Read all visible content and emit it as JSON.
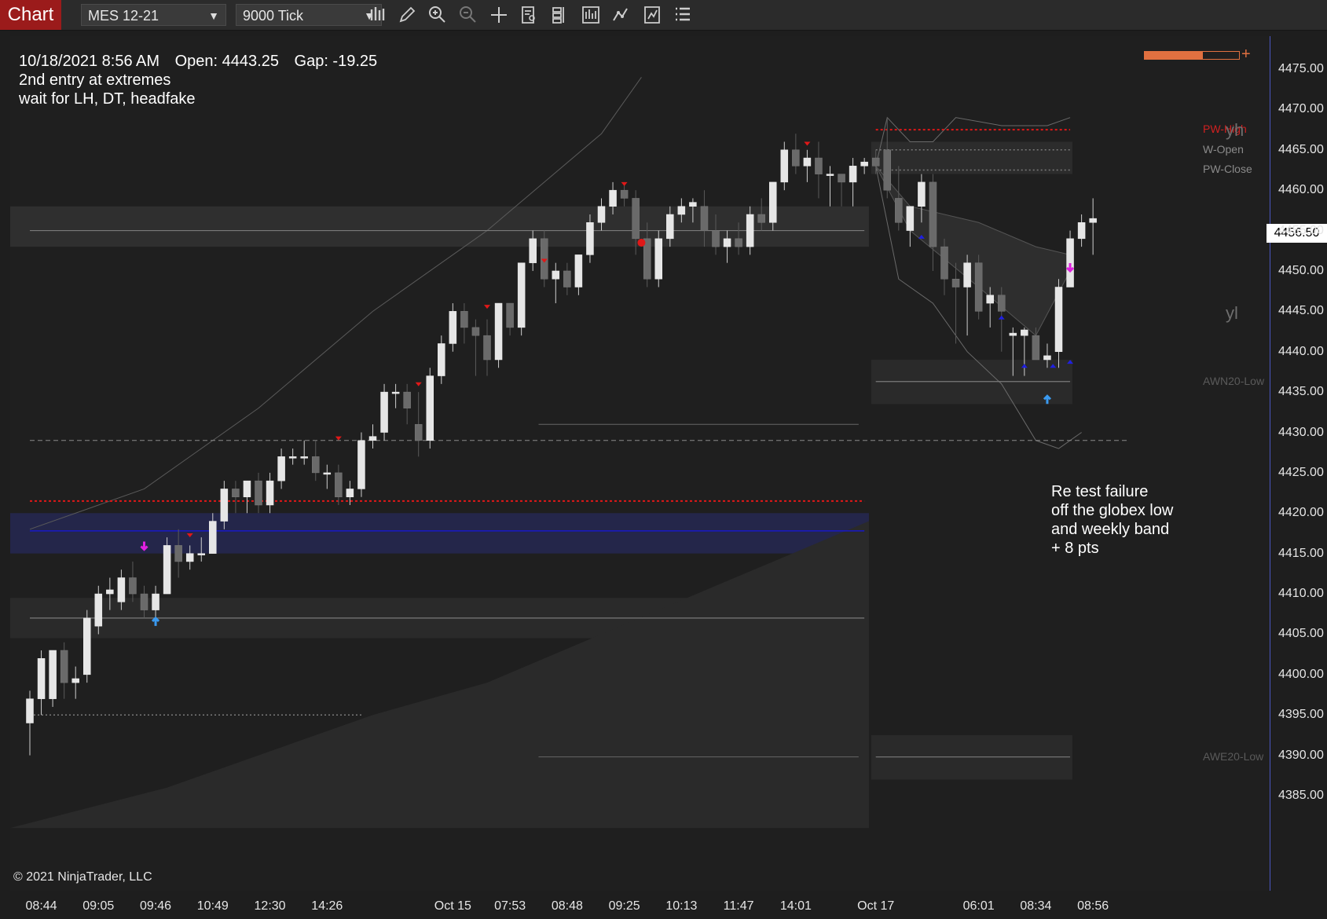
{
  "toolbar": {
    "app_tab": "Chart",
    "instrument": "MES 12-21",
    "period": "9000 Tick",
    "tools": [
      {
        "icon": "bar-type-icon"
      },
      {
        "icon": "draw-pencil-icon"
      },
      {
        "icon": "zoom-in-icon"
      },
      {
        "icon": "zoom-out-icon"
      },
      {
        "icon": "crosshair-icon"
      },
      {
        "icon": "data-box-icon"
      },
      {
        "icon": "templates-icon"
      },
      {
        "icon": "indicators-icon"
      },
      {
        "icon": "strategies-icon"
      },
      {
        "icon": "chart-properties-icon"
      },
      {
        "icon": "menu-list-icon"
      }
    ]
  },
  "info": {
    "datetime": "10/18/2021 8:56 AM",
    "open": "Open: 4443.25",
    "gap": "Gap: -19.25",
    "line2": "2nd entry at extremes",
    "line3": "wait for LH, DT, headfake"
  },
  "annotation": [
    "Re test failure",
    "off the globex low",
    "and weekly band",
    "+ 8 pts"
  ],
  "copyright": "© 2021 NinjaTrader, LLC",
  "level_labels": [
    {
      "text": "PW-High",
      "price": 4467.5,
      "color": "#d02020"
    },
    {
      "text": "W-Open",
      "price": 4465.0,
      "color": "#8a8a8a"
    },
    {
      "text": "PW-Close",
      "price": 4462.5,
      "color": "#8a8a8a"
    },
    {
      "text": "AWN20-Low",
      "price": 4436.3,
      "color": "#5a5a5a"
    },
    {
      "text": "AWE20-Low",
      "price": 4389.8,
      "color": "#5a5a5a"
    }
  ],
  "tags": [
    {
      "text": "yh",
      "price": 4467.5
    },
    {
      "text": "yl",
      "price": 4444.8
    }
  ],
  "last_price": "4456.50",
  "zoom_fraction": 0.62,
  "colors": {
    "up_candle": "#e6e6e6",
    "down_candle": "#6a6a6a",
    "red_level": "#e01818",
    "blue_level": "#1818c8",
    "axis_border": "#4a56c0"
  },
  "chart_data": {
    "type": "candlestick",
    "instrument": "MES 12-21",
    "ylim": [
      4381,
      4479
    ],
    "y_ticks": [
      4385,
      4390,
      4395,
      4400,
      4405,
      4410,
      4415,
      4420,
      4425,
      4430,
      4435,
      4440,
      4445,
      4450,
      4455,
      4460,
      4465,
      4470,
      4475
    ],
    "x_ticks": [
      {
        "label": "08:44",
        "index": 1
      },
      {
        "label": "09:05",
        "index": 6
      },
      {
        "label": "09:46",
        "index": 11
      },
      {
        "label": "10:49",
        "index": 16
      },
      {
        "label": "12:30",
        "index": 21
      },
      {
        "label": "14:26",
        "index": 26
      },
      {
        "label": "Oct 15",
        "index": 37
      },
      {
        "label": "07:53",
        "index": 42
      },
      {
        "label": "08:48",
        "index": 47
      },
      {
        "label": "09:25",
        "index": 52
      },
      {
        "label": "10:13",
        "index": 57
      },
      {
        "label": "11:47",
        "index": 62
      },
      {
        "label": "14:01",
        "index": 67
      },
      {
        "label": "Oct 17",
        "index": 74
      },
      {
        "label": "06:01",
        "index": 83
      },
      {
        "label": "08:34",
        "index": 88
      },
      {
        "label": "08:56",
        "index": 93
      }
    ],
    "candles": [
      {
        "o": 4394,
        "h": 4398,
        "l": 4390,
        "c": 4397
      },
      {
        "o": 4397,
        "h": 4403,
        "l": 4395,
        "c": 4402
      },
      {
        "o": 4397,
        "h": 4403,
        "l": 4396,
        "c": 4403
      },
      {
        "o": 4403,
        "h": 4404,
        "l": 4397,
        "c": 4399
      },
      {
        "o": 4399,
        "h": 4401,
        "l": 4397,
        "c": 4399.5
      },
      {
        "o": 4400,
        "h": 4408,
        "l": 4399,
        "c": 4407
      },
      {
        "o": 4406,
        "h": 4411,
        "l": 4405,
        "c": 4410
      },
      {
        "o": 4410,
        "h": 4412,
        "l": 4408,
        "c": 4410.5
      },
      {
        "o": 4409,
        "h": 4413,
        "l": 4408,
        "c": 4412
      },
      {
        "o": 4412,
        "h": 4414,
        "l": 4409,
        "c": 4410
      },
      {
        "o": 4410,
        "h": 4411,
        "l": 4407,
        "c": 4408
      },
      {
        "o": 4408,
        "h": 4411,
        "l": 4407,
        "c": 4410
      },
      {
        "o": 4410,
        "h": 4417,
        "l": 4410,
        "c": 4416
      },
      {
        "o": 4416,
        "h": 4418,
        "l": 4412,
        "c": 4414
      },
      {
        "o": 4414,
        "h": 4416,
        "l": 4413,
        "c": 4415
      },
      {
        "o": 4415,
        "h": 4417,
        "l": 4414,
        "c": 4415
      },
      {
        "o": 4415,
        "h": 4420,
        "l": 4415,
        "c": 4419
      },
      {
        "o": 4419,
        "h": 4424,
        "l": 4418,
        "c": 4423
      },
      {
        "o": 4423,
        "h": 4424,
        "l": 4420,
        "c": 4422
      },
      {
        "o": 4422,
        "h": 4424,
        "l": 4420,
        "c": 4424
      },
      {
        "o": 4424,
        "h": 4425,
        "l": 4420,
        "c": 4421
      },
      {
        "o": 4421,
        "h": 4425,
        "l": 4420,
        "c": 4424
      },
      {
        "o": 4424,
        "h": 4428,
        "l": 4423,
        "c": 4427
      },
      {
        "o": 4427,
        "h": 4428,
        "l": 4426,
        "c": 4427
      },
      {
        "o": 4427,
        "h": 4429,
        "l": 4426,
        "c": 4427
      },
      {
        "o": 4427,
        "h": 4429,
        "l": 4424,
        "c": 4425
      },
      {
        "o": 4425,
        "h": 4426,
        "l": 4423,
        "c": 4425
      },
      {
        "o": 4425,
        "h": 4426,
        "l": 4421,
        "c": 4422
      },
      {
        "o": 4422,
        "h": 4424,
        "l": 4421,
        "c": 4423
      },
      {
        "o": 4423,
        "h": 4430,
        "l": 4422,
        "c": 4429
      },
      {
        "o": 4429,
        "h": 4431,
        "l": 4428,
        "c": 4429.5
      },
      {
        "o": 4430,
        "h": 4436,
        "l": 4429,
        "c": 4435
      },
      {
        "o": 4435,
        "h": 4436,
        "l": 4433,
        "c": 4435
      },
      {
        "o": 4435,
        "h": 4436,
        "l": 4431,
        "c": 4433
      },
      {
        "o": 4431,
        "h": 4435,
        "l": 4427,
        "c": 4429
      },
      {
        "o": 4429,
        "h": 4438,
        "l": 4428,
        "c": 4437
      },
      {
        "o": 4437,
        "h": 4442,
        "l": 4436,
        "c": 4441
      },
      {
        "o": 4441,
        "h": 4446,
        "l": 4440,
        "c": 4445
      },
      {
        "o": 4445,
        "h": 4446,
        "l": 4441,
        "c": 4443
      },
      {
        "o": 4443,
        "h": 4444,
        "l": 4437,
        "c": 4442
      },
      {
        "o": 4442,
        "h": 4444,
        "l": 4437,
        "c": 4439
      },
      {
        "o": 4439,
        "h": 4446,
        "l": 4438,
        "c": 4446
      },
      {
        "o": 4446,
        "h": 4446,
        "l": 4442,
        "c": 4443
      },
      {
        "o": 4443,
        "h": 4451,
        "l": 4442,
        "c": 4451
      },
      {
        "o": 4451,
        "h": 4455,
        "l": 4450,
        "c": 4454
      },
      {
        "o": 4454,
        "h": 4455,
        "l": 4448,
        "c": 4449
      },
      {
        "o": 4449,
        "h": 4451,
        "l": 4446,
        "c": 4450
      },
      {
        "o": 4450,
        "h": 4451,
        "l": 4447,
        "c": 4448
      },
      {
        "o": 4448,
        "h": 4452,
        "l": 4447,
        "c": 4452
      },
      {
        "o": 4452,
        "h": 4457,
        "l": 4451,
        "c": 4456
      },
      {
        "o": 4456,
        "h": 4459,
        "l": 4455,
        "c": 4458
      },
      {
        "o": 4458,
        "h": 4461,
        "l": 4457,
        "c": 4460
      },
      {
        "o": 4460,
        "h": 4461,
        "l": 4458,
        "c": 4459
      },
      {
        "o": 4459,
        "h": 4460,
        "l": 4452,
        "c": 4454
      },
      {
        "o": 4454,
        "h": 4456,
        "l": 4448,
        "c": 4449
      },
      {
        "o": 4449,
        "h": 4455,
        "l": 4448,
        "c": 4454
      },
      {
        "o": 4454,
        "h": 4458,
        "l": 4453,
        "c": 4457
      },
      {
        "o": 4457,
        "h": 4459,
        "l": 4456,
        "c": 4458
      },
      {
        "o": 4458,
        "h": 4459,
        "l": 4456,
        "c": 4458.5
      },
      {
        "o": 4458,
        "h": 4460,
        "l": 4453,
        "c": 4455
      },
      {
        "o": 4455,
        "h": 4457,
        "l": 4452,
        "c": 4453
      },
      {
        "o": 4453,
        "h": 4455,
        "l": 4451,
        "c": 4454
      },
      {
        "o": 4454,
        "h": 4456,
        "l": 4452,
        "c": 4453
      },
      {
        "o": 4453,
        "h": 4458,
        "l": 4452,
        "c": 4457
      },
      {
        "o": 4457,
        "h": 4459,
        "l": 4455,
        "c": 4456
      },
      {
        "o": 4456,
        "h": 4461,
        "l": 4455,
        "c": 4461
      },
      {
        "o": 4461,
        "h": 4466,
        "l": 4460,
        "c": 4465
      },
      {
        "o": 4465,
        "h": 4467,
        "l": 4462,
        "c": 4463
      },
      {
        "o": 4463,
        "h": 4465,
        "l": 4461,
        "c": 4464
      },
      {
        "o": 4464,
        "h": 4466,
        "l": 4459,
        "c": 4462
      },
      {
        "o": 4462,
        "h": 4463,
        "l": 4458,
        "c": 4462
      },
      {
        "o": 4462,
        "h": 4462,
        "l": 4458,
        "c": 4461
      },
      {
        "o": 4461,
        "h": 4464,
        "l": 4458,
        "c": 4463
      },
      {
        "o": 4463,
        "h": 4464,
        "l": 4462,
        "c": 4463.5
      },
      {
        "o": 4464,
        "h": 4465,
        "l": 4462,
        "c": 4463
      },
      {
        "o": 4465,
        "h": 4469,
        "l": 4459,
        "c": 4460
      },
      {
        "o": 4459,
        "h": 4463,
        "l": 4455,
        "c": 4456
      },
      {
        "o": 4455,
        "h": 4457,
        "l": 4453,
        "c": 4458
      },
      {
        "o": 4458,
        "h": 4462,
        "l": 4456,
        "c": 4461
      },
      {
        "o": 4461,
        "h": 4462,
        "l": 4450,
        "c": 4453
      },
      {
        "o": 4453,
        "h": 4454,
        "l": 4447,
        "c": 4449
      },
      {
        "o": 4449,
        "h": 4451,
        "l": 4441,
        "c": 4448
      },
      {
        "o": 4448,
        "h": 4452,
        "l": 4442,
        "c": 4451
      },
      {
        "o": 4451,
        "h": 4452,
        "l": 4444,
        "c": 4445
      },
      {
        "o": 4446,
        "h": 4448,
        "l": 4443,
        "c": 4447
      },
      {
        "o": 4447,
        "h": 4448,
        "l": 4440,
        "c": 4445
      },
      {
        "o": 4442,
        "h": 4443,
        "l": 4437,
        "c": 4442.3
      },
      {
        "o": 4442,
        "h": 4443,
        "l": 4437,
        "c": 4442.7
      },
      {
        "o": 4442,
        "h": 4443,
        "l": 4439,
        "c": 4439
      },
      {
        "o": 4439,
        "h": 4441,
        "l": 4438,
        "c": 4439.5
      },
      {
        "o": 4440,
        "h": 4449,
        "l": 4438,
        "c": 4448
      },
      {
        "o": 4448,
        "h": 4455,
        "l": 4448,
        "c": 4454
      },
      {
        "o": 4454,
        "h": 4457,
        "l": 4453,
        "c": 4456
      },
      {
        "o": 4456,
        "h": 4459,
        "l": 4452,
        "c": 4456.5
      }
    ],
    "levels": [
      {
        "price": 4467.5,
        "style": "red-dotted",
        "from": 74,
        "to": 91
      },
      {
        "price": 4465.0,
        "style": "gray-dotted",
        "from": 74,
        "to": 91
      },
      {
        "price": 4462.5,
        "style": "gray-dotted",
        "from": 74,
        "to": 91
      },
      {
        "price": 4455.0,
        "style": "gray-solid",
        "from": 0,
        "to": 73
      },
      {
        "price": 4429.0,
        "style": "gray-dashed",
        "from": 0,
        "to": 96
      },
      {
        "price": 4421.5,
        "style": "red-dotted",
        "from": 0,
        "to": 73
      },
      {
        "price": 4417.8,
        "style": "blue-solid",
        "from": 0,
        "to": 73
      },
      {
        "price": 4407.0,
        "style": "gray-solid",
        "from": 0,
        "to": 73
      },
      {
        "price": 4395.0,
        "style": "gray-dotted",
        "from": 0,
        "to": 29
      },
      {
        "price": 4436.3,
        "style": "gray-solid",
        "from": 74,
        "to": 91
      },
      {
        "price": 4389.8,
        "style": "gray-solid",
        "from": 74,
        "to": 91
      }
    ]
  }
}
